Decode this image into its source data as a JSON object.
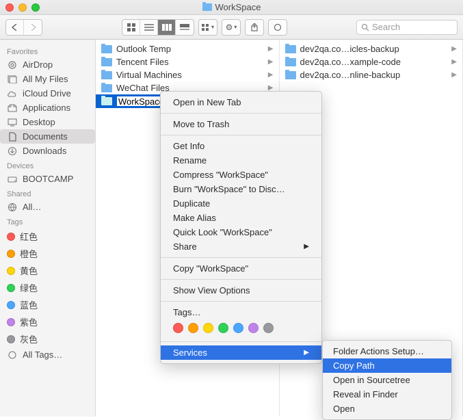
{
  "window": {
    "title": "WorkSpace"
  },
  "search": {
    "placeholder": "Search"
  },
  "sidebar": {
    "favorites": {
      "header": "Favorites",
      "items": [
        {
          "label": "AirDrop"
        },
        {
          "label": "All My Files"
        },
        {
          "label": "iCloud Drive"
        },
        {
          "label": "Applications"
        },
        {
          "label": "Desktop"
        },
        {
          "label": "Documents"
        },
        {
          "label": "Downloads"
        }
      ]
    },
    "devices": {
      "header": "Devices",
      "items": [
        {
          "label": "BOOTCAMP"
        }
      ]
    },
    "shared": {
      "header": "Shared",
      "items": [
        {
          "label": "All…"
        }
      ]
    },
    "tags": {
      "header": "Tags",
      "items": [
        {
          "label": "红色",
          "color": "#ff5b54"
        },
        {
          "label": "橙色",
          "color": "#ff9f0a"
        },
        {
          "label": "黄色",
          "color": "#ffd60a"
        },
        {
          "label": "绿色",
          "color": "#30d158"
        },
        {
          "label": "蓝色",
          "color": "#4aa7ff"
        },
        {
          "label": "紫色",
          "color": "#c183e9"
        },
        {
          "label": "灰色",
          "color": "#98989d"
        }
      ],
      "all": "All Tags…"
    }
  },
  "column1": [
    {
      "name": "Outlook Temp"
    },
    {
      "name": "Tencent Files"
    },
    {
      "name": "Virtual Machines"
    },
    {
      "name": "WeChat Files"
    },
    {
      "name": "WorkSpace",
      "selected": true,
      "renaming": true
    }
  ],
  "column2": [
    {
      "name": "dev2qa.co…icles-backup"
    },
    {
      "name": "dev2qa.co…xample-code"
    },
    {
      "name": "dev2qa.co…nline-backup"
    }
  ],
  "context_menu": {
    "open_new_tab": "Open in New Tab",
    "move_to_trash": "Move to Trash",
    "get_info": "Get Info",
    "rename": "Rename",
    "compress": "Compress \"WorkSpace\"",
    "burn": "Burn \"WorkSpace\" to Disc…",
    "duplicate": "Duplicate",
    "make_alias": "Make Alias",
    "quick_look": "Quick Look \"WorkSpace\"",
    "share": "Share",
    "copy": "Copy \"WorkSpace\"",
    "show_view_options": "Show View Options",
    "tags_label": "Tags…",
    "services": "Services",
    "tag_colors": [
      "#ff5b54",
      "#ff9f0a",
      "#ffd60a",
      "#30d158",
      "#4aa7ff",
      "#c183e9",
      "#98989d"
    ]
  },
  "services_submenu": {
    "folder_actions": "Folder Actions Setup…",
    "copy_path": "Copy Path",
    "open_sourcetree": "Open in Sourcetree",
    "reveal_finder": "Reveal in Finder",
    "open": "Open"
  }
}
